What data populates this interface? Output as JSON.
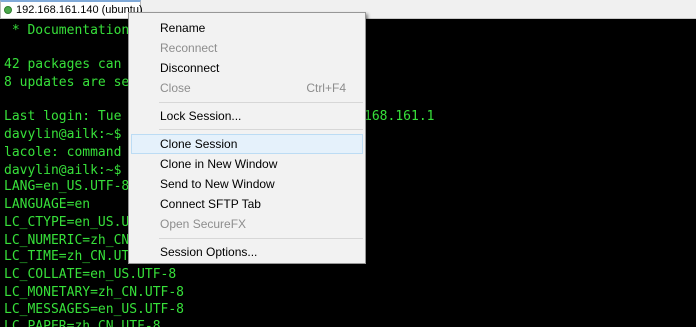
{
  "tab": {
    "label": "192.168.161.140 (ubuntu)"
  },
  "terminal": {
    "lines": [
      " * Documentation:  https://help.ubuntu.com",
      "",
      "42 packages can be updated.",
      "8 updates are security updates.",
      "",
      "Last login: Tue Jul 31 10:44:05 2018 from 192.168.161.1",
      "davylin@ailk:~$ locale",
      "lacole: command not found",
      "davylin@ailk:~$ locale",
      "LANG=en_US.UTF-8",
      "LANGUAGE=en",
      "LC_CTYPE=en_US.UTF-8",
      "LC_NUMERIC=zh_CN.UTF-8",
      "LC_TIME=zh_CN.UTF-8",
      "LC_COLLATE=en_US.UTF-8",
      "LC_MONETARY=zh_CN.UTF-8",
      "LC_MESSAGES=en_US.UTF-8",
      "LC_PAPER=zh_CN.UTF-8"
    ]
  },
  "context_menu": {
    "rename": "Rename",
    "reconnect": "Reconnect",
    "disconnect": "Disconnect",
    "close": "Close",
    "close_shortcut": "Ctrl+F4",
    "lock_session": "Lock Session...",
    "clone_session": "Clone Session",
    "clone_new_window": "Clone in New Window",
    "send_new_window": "Send to New Window",
    "connect_sftp": "Connect SFTP Tab",
    "open_securefx": "Open SecureFX",
    "session_options": "Session Options..."
  },
  "colors": {
    "terminal_text": "#37e03a",
    "terminal_bg": "#000000",
    "menu_hover": "#e5f1fb"
  }
}
